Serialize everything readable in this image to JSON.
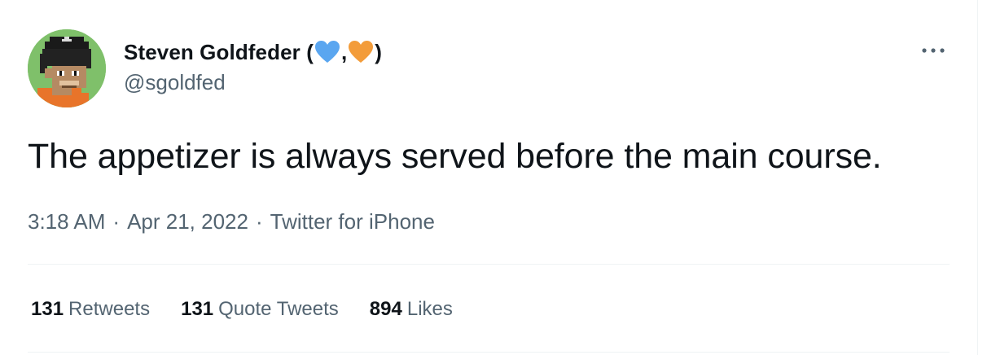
{
  "author": {
    "display_name": "Steven Goldfeder (",
    "name_comma": ",",
    "name_close": ")",
    "handle": "@sgoldfed",
    "avatar_icon": "pixel-ape-avatar",
    "heart_colors": [
      "#5aa6f0",
      "#f39c3a"
    ]
  },
  "tweet": {
    "text": "The appetizer is always served before the main course.",
    "time": "3:18 AM",
    "separator": "·",
    "date": "Apr 21, 2022",
    "source": "Twitter for iPhone"
  },
  "stats": {
    "retweets_count": "131",
    "retweets_label": "Retweets",
    "quotes_count": "131",
    "quotes_label": "Quote Tweets",
    "likes_count": "894",
    "likes_label": "Likes"
  },
  "more_icon": "more-horizontal-icon"
}
